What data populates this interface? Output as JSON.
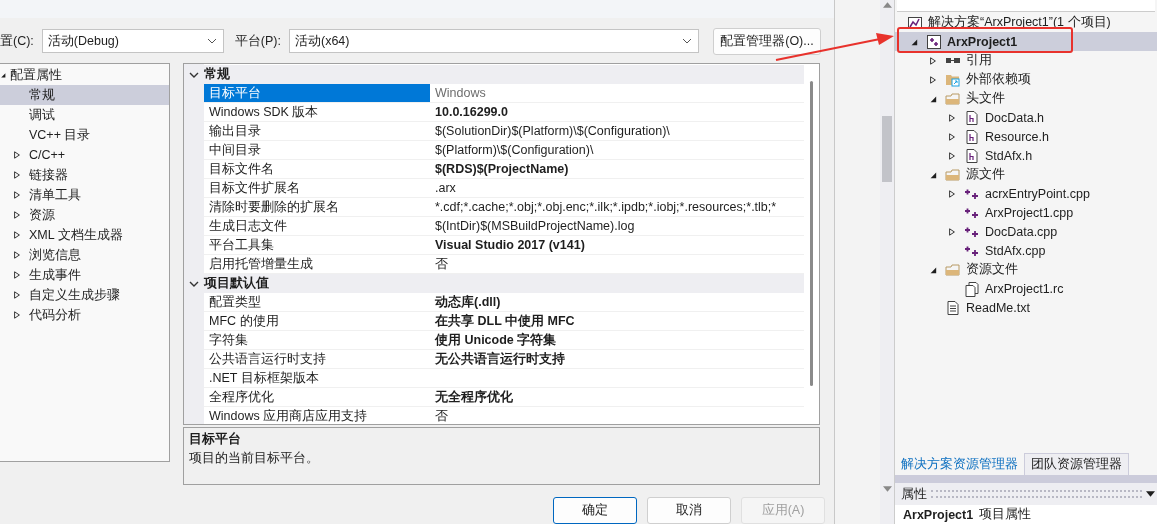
{
  "dialog": {
    "config_label": "置(C):",
    "configuration": "活动(Debug)",
    "platform_label": "平台(P):",
    "platform": "活动(x64)",
    "config_manager_button": "配置管理器(O)...",
    "nav_tree": [
      {
        "label": "配置属性",
        "expanded": true,
        "selected": false,
        "children": [
          {
            "label": "常规",
            "selected": true
          },
          {
            "label": "调试",
            "selected": false
          },
          {
            "label": "VC++ 目录",
            "selected": false
          },
          {
            "label": "C/C++",
            "expanded": false,
            "selected": false
          },
          {
            "label": "链接器",
            "expanded": false,
            "selected": false
          },
          {
            "label": "清单工具",
            "expanded": false,
            "selected": false
          },
          {
            "label": "资源",
            "expanded": false,
            "selected": false
          },
          {
            "label": "XML 文档生成器",
            "expanded": false,
            "selected": false
          },
          {
            "label": "浏览信息",
            "expanded": false,
            "selected": false
          },
          {
            "label": "生成事件",
            "expanded": false,
            "selected": false
          },
          {
            "label": "自定义生成步骤",
            "expanded": false,
            "selected": false
          },
          {
            "label": "代码分析",
            "expanded": false,
            "selected": false
          }
        ]
      }
    ],
    "property_grid": {
      "categories": [
        {
          "label": "常规",
          "expanded": true,
          "rows": [
            {
              "name": "目标平台",
              "value": "Windows",
              "bold": false,
              "inherited": true,
              "selected": true
            },
            {
              "name": "Windows SDK 版本",
              "value": "10.0.16299.0",
              "bold": true,
              "inherited": false,
              "selected": false
            },
            {
              "name": "输出目录",
              "value": "$(SolutionDir)$(Platform)\\$(Configuration)\\",
              "bold": false,
              "inherited": false,
              "selected": false
            },
            {
              "name": "中间目录",
              "value": "$(Platform)\\$(Configuration)\\",
              "bold": false,
              "inherited": false,
              "selected": false
            },
            {
              "name": "目标文件名",
              "value": "$(RDS)$(ProjectName)",
              "bold": true,
              "inherited": false,
              "selected": false
            },
            {
              "name": "目标文件扩展名",
              "value": ".arx",
              "bold": false,
              "inherited": false,
              "selected": false
            },
            {
              "name": "清除时要删除的扩展名",
              "value": "*.cdf;*.cache;*.obj;*.obj.enc;*.ilk;*.ipdb;*.iobj;*.resources;*.tlb;*",
              "bold": false,
              "inherited": false,
              "selected": false
            },
            {
              "name": "生成日志文件",
              "value": "$(IntDir)$(MSBuildProjectName).log",
              "bold": false,
              "inherited": false,
              "selected": false
            },
            {
              "name": "平台工具集",
              "value": "Visual Studio 2017 (v141)",
              "bold": true,
              "inherited": false,
              "selected": false
            },
            {
              "name": "启用托管增量生成",
              "value": "否",
              "bold": false,
              "inherited": false,
              "selected": false
            }
          ]
        },
        {
          "label": "项目默认值",
          "expanded": true,
          "rows": [
            {
              "name": "配置类型",
              "value": "动态库(.dll)",
              "bold": true,
              "inherited": false,
              "selected": false
            },
            {
              "name": "MFC 的使用",
              "value": "在共享 DLL 中使用 MFC",
              "bold": true,
              "inherited": false,
              "selected": false
            },
            {
              "name": "字符集",
              "value": "使用 Unicode 字符集",
              "bold": true,
              "inherited": false,
              "selected": false
            },
            {
              "name": "公共语言运行时支持",
              "value": "无公共语言运行时支持",
              "bold": true,
              "inherited": false,
              "selected": false
            },
            {
              "name": ".NET 目标框架版本",
              "selected": false
            },
            {
              "name": "全程序优化",
              "value": "无全程序优化",
              "bold": true,
              "inherited": false,
              "selected": false
            },
            {
              "name": "Windows 应用商店应用支持",
              "value": "否",
              "bold": false,
              "inherited": false,
              "selected": false
            }
          ]
        }
      ]
    },
    "description": {
      "title": "目标平台",
      "text": "项目的当前目标平台。"
    },
    "buttons": [
      {
        "label": "确定",
        "kind": "default",
        "disabled": false
      },
      {
        "label": "取消",
        "kind": "normal",
        "disabled": false
      },
      {
        "label": "应用(A)",
        "kind": "normal",
        "disabled": true
      }
    ]
  },
  "solution_explorer": {
    "solution": {
      "label": "解决方案“ArxProject1”(1 个项目)"
    },
    "tree": [
      {
        "label": "ArxProject1",
        "kind": "project",
        "expanded": true,
        "selected": true,
        "children": [
          {
            "label": "引用",
            "kind": "references",
            "expanded": false,
            "selected": false
          },
          {
            "label": "外部依赖项",
            "kind": "external",
            "expanded": false,
            "selected": false
          },
          {
            "label": "头文件",
            "kind": "folder",
            "expanded": true,
            "selected": false,
            "children": [
              {
                "label": "DocData.h",
                "kind": "header",
                "expanded": false,
                "selected": false
              },
              {
                "label": "Resource.h",
                "kind": "header",
                "expanded": false,
                "selected": false
              },
              {
                "label": "StdAfx.h",
                "kind": "header",
                "expanded": false,
                "selected": false
              }
            ]
          },
          {
            "label": "源文件",
            "kind": "folder",
            "expanded": true,
            "selected": false,
            "children": [
              {
                "label": "acrxEntryPoint.cpp",
                "kind": "cpp",
                "expanded": false,
                "selected": false
              },
              {
                "label": "ArxProject1.cpp",
                "kind": "cpp",
                "selected": false
              },
              {
                "label": "DocData.cpp",
                "kind": "cpp",
                "expanded": false,
                "selected": false
              },
              {
                "label": "StdAfx.cpp",
                "kind": "cpp",
                "selected": false
              }
            ]
          },
          {
            "label": "资源文件",
            "kind": "folder",
            "expanded": true,
            "selected": false,
            "children": [
              {
                "label": "ArxProject1.rc",
                "kind": "resource",
                "selected": false
              }
            ]
          },
          {
            "label": "ReadMe.txt",
            "kind": "text",
            "selected": false
          }
        ]
      }
    ],
    "tabs": [
      {
        "label": "解决方案资源管理器",
        "selected": true
      },
      {
        "label": "团队资源管理器",
        "selected": false
      }
    ],
    "properties": {
      "title": "属性",
      "object_name": "ArxProject1",
      "object_type": "项目属性"
    }
  }
}
